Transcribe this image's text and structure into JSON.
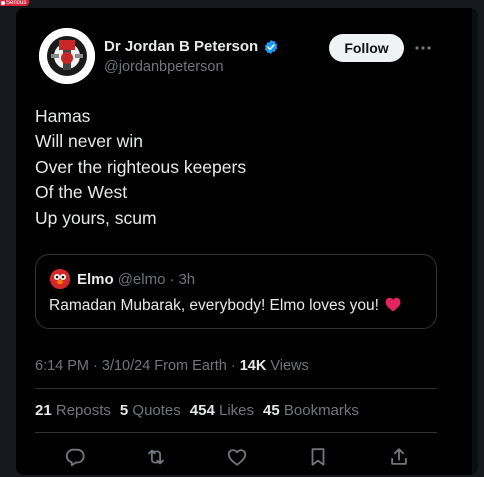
{
  "overlay_tag": "Serious",
  "author": {
    "name": "Dr Jordan B Peterson",
    "handle": "@jordanbpeterson"
  },
  "follow_label": "Follow",
  "tweet_lines": [
    "Hamas",
    "Will never win",
    "Over the righteous keepers",
    "Of the West",
    "Up yours, scum"
  ],
  "quoted": {
    "name": "Elmo",
    "handle": "@elmo",
    "dot": "·",
    "time": "3h",
    "text": "Ramadan Mubarak, everybody! Elmo loves you!"
  },
  "meta": {
    "time": "6:14 PM",
    "sep1": " · ",
    "date": "3/10/24",
    "source": " From Earth",
    "sep2": " · ",
    "views_count": "14K",
    "views_label": " Views"
  },
  "stats": {
    "reposts_count": "21",
    "reposts_label": "Reposts",
    "quotes_count": "5",
    "quotes_label": "Quotes",
    "likes_count": "454",
    "likes_label": "Likes",
    "bookmarks_count": "45",
    "bookmarks_label": "Bookmarks"
  },
  "colors": {
    "background": "#000000",
    "text": "#e7e9ea",
    "muted": "#71767b",
    "verified": "#1d9bf0",
    "heart": "#f91880",
    "border": "#2f3336"
  },
  "icons": [
    "verified-badge-icon",
    "more-icon",
    "reply-icon",
    "repost-icon",
    "like-icon",
    "bookmark-icon",
    "share-icon",
    "heart-emoji-icon"
  ]
}
